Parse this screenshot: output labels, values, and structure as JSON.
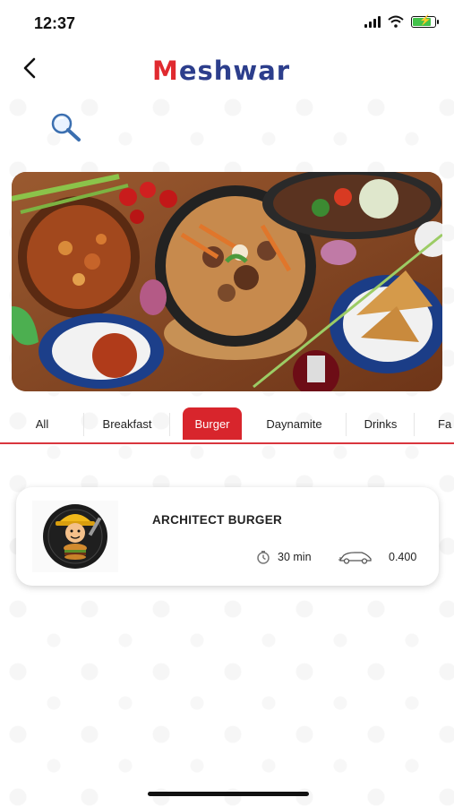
{
  "status_bar": {
    "time": "12:37"
  },
  "header": {
    "logo_first": "M",
    "logo_rest": "eshwar"
  },
  "colors": {
    "brand_red": "#d8252c",
    "brand_blue": "#2c3e8c"
  },
  "icons": {
    "back": "chevron-left-icon",
    "search": "magnifier-icon",
    "time": "timer-icon",
    "delivery": "car-icon"
  },
  "tabs": [
    {
      "label": "All"
    },
    {
      "label": "Breakfast"
    },
    {
      "label": "Burger",
      "active": true
    },
    {
      "label": "Daynamite"
    },
    {
      "label": "Drinks"
    },
    {
      "label": "Fa"
    }
  ],
  "restaurants": [
    {
      "name": "ARCHITECT BURGER",
      "time": "30 min",
      "delivery_fee": "0.400",
      "logo_text": "ARCHITECT BURGER"
    }
  ]
}
